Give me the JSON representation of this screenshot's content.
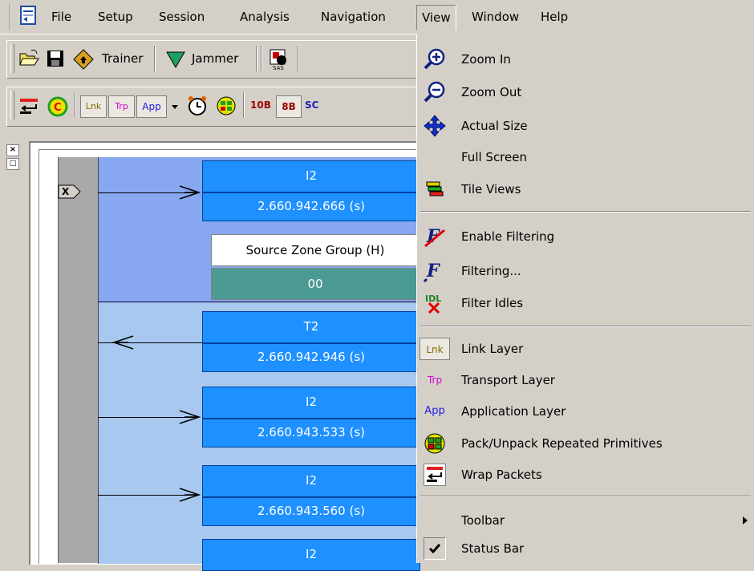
{
  "menubar": {
    "items": [
      {
        "label": "File",
        "open": false
      },
      {
        "label": "Setup",
        "open": false
      },
      {
        "label": "Session",
        "open": false
      },
      {
        "label": "Analysis",
        "open": false
      },
      {
        "label": "Navigation",
        "open": false
      },
      {
        "label": "View",
        "open": true
      },
      {
        "label": "Window",
        "open": false
      },
      {
        "label": "Help",
        "open": false
      }
    ]
  },
  "toolbar1": {
    "trainer_label": "Trainer",
    "jammer_label": "Jammer"
  },
  "toolbar2": {
    "lnk": "Lnk",
    "trp": "Trp",
    "app": "App",
    "b10": "10B",
    "b8": "8B",
    "sc": "SC"
  },
  "trace": {
    "marker": "X",
    "packets": [
      {
        "name": "I2",
        "time": "2.660.942.666 (s)",
        "direction": "right"
      },
      {
        "name": "T2",
        "time": "2.660.942.946 (s)",
        "direction": "left"
      },
      {
        "name": "I2",
        "time": "2.660.943.533 (s)",
        "direction": "right"
      },
      {
        "name": "I2",
        "time": "2.660.943.560 (s)",
        "direction": "right"
      },
      {
        "name": "I2",
        "time": "",
        "direction": "right"
      }
    ],
    "field_label": "Source Zone Group (H)",
    "field_value": "00"
  },
  "view_menu": {
    "zoom_in": "Zoom In",
    "zoom_out": "Zoom Out",
    "actual_size": "Actual Size",
    "full_screen": "Full Screen",
    "tile_views": "Tile Views",
    "enable_filtering": "Enable Filtering",
    "filtering": "Filtering...",
    "filter_idles": "Filter Idles",
    "link_layer": "Link Layer",
    "transport_layer": "Transport Layer",
    "application_layer": "Application Layer",
    "pack_unpack": "Pack/Unpack Repeated Primitives",
    "wrap_packets": "Wrap Packets",
    "toolbar": "Toolbar",
    "status_bar": "Status Bar"
  },
  "colors": {
    "packet_blue": "#1e90ff",
    "field_teal": "#4b9a94",
    "menu_gray": "#d4d0c8"
  }
}
